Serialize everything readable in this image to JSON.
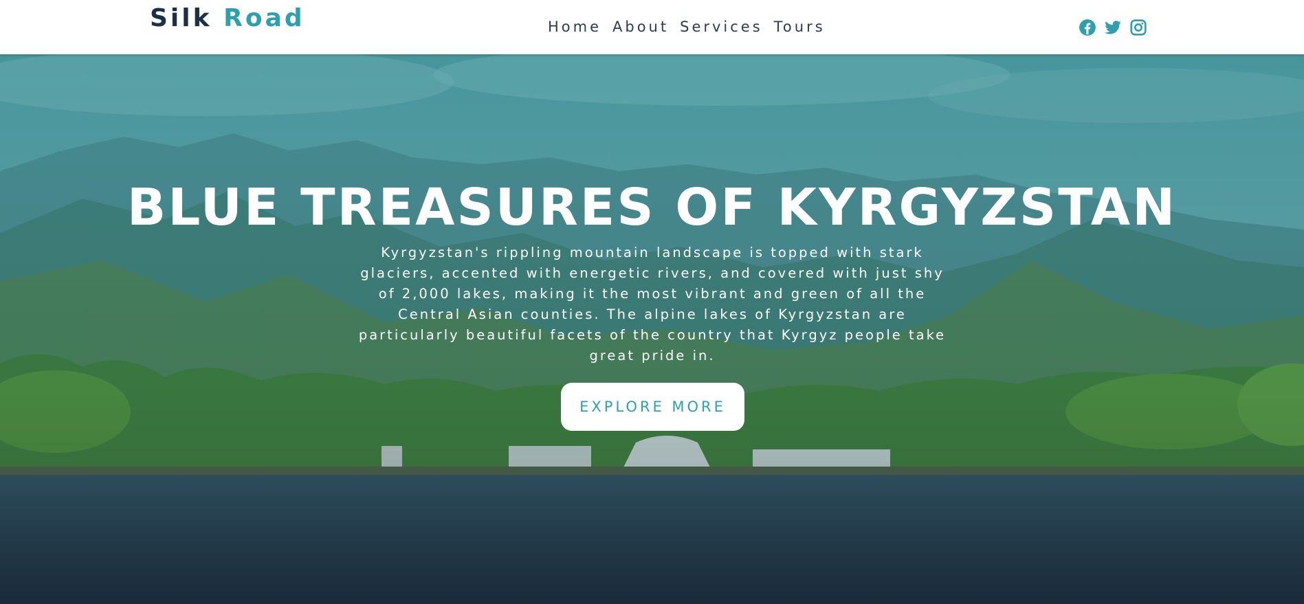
{
  "header": {
    "brand_part1": "Silk",
    "brand_part2": "Road",
    "nav": [
      "Home",
      "About",
      "Services",
      "Tours"
    ]
  },
  "social_icons": [
    "facebook-icon",
    "twitter-icon",
    "instagram-icon"
  ],
  "hero": {
    "title": "BLUE TREASURES OF KYRGYZSTAN",
    "description": "Kyrgyzstan's rippling mountain landscape is topped with stark glaciers, accented with energetic rivers, and covered with just shy of 2,000 lakes, making it the most vibrant and green of all the Central Asian counties. The alpine lakes of Kyrgyzstan are particularly beautiful facets of the country that Kyrgyz people take great pride in.",
    "cta": "EXPLORE MORE"
  },
  "colors": {
    "brand_dark": "#1b2f45",
    "accent": "#2f9fae",
    "nav_text": "#2b3c4e",
    "overlay": "#3e8f98"
  }
}
